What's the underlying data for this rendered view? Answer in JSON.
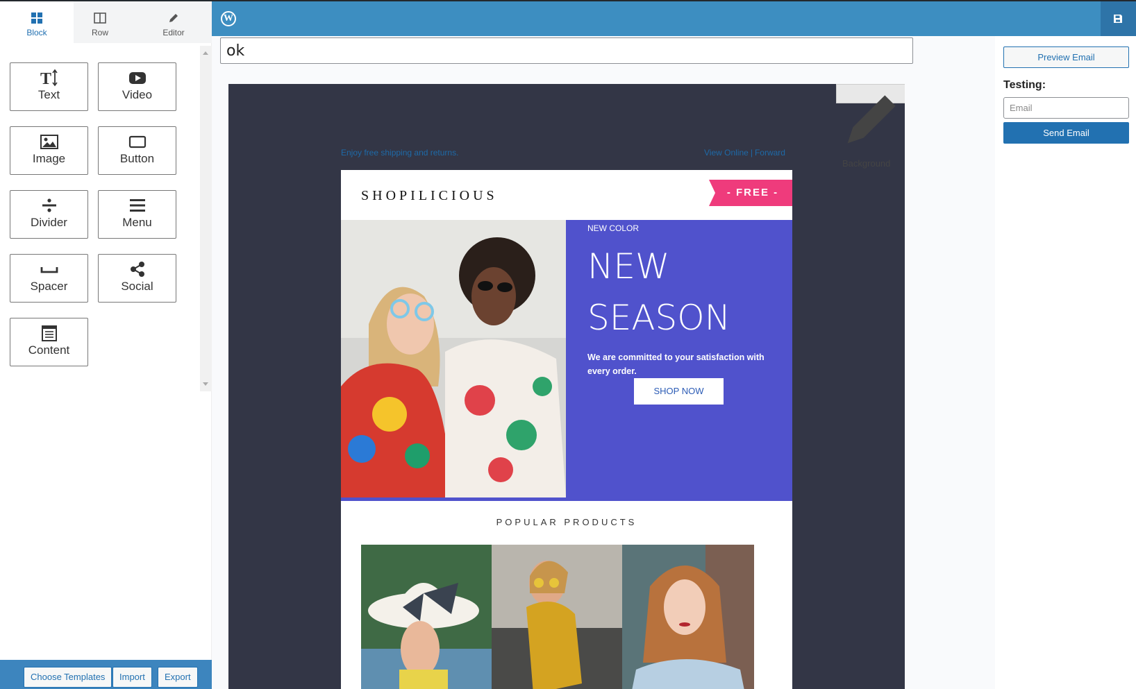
{
  "left_panel": {
    "tabs": [
      {
        "label": "Block",
        "icon": "grid-icon",
        "active": true
      },
      {
        "label": "Row",
        "icon": "columns-icon",
        "active": false
      },
      {
        "label": "Editor",
        "icon": "pencil-icon",
        "active": false
      }
    ],
    "blocks": [
      {
        "label": "Text",
        "icon": "text-icon"
      },
      {
        "label": "Video",
        "icon": "youtube-icon"
      },
      {
        "label": "Image",
        "icon": "image-icon"
      },
      {
        "label": "Button",
        "icon": "button-icon"
      },
      {
        "label": "Divider",
        "icon": "divide-icon"
      },
      {
        "label": "Menu",
        "icon": "menu-icon"
      },
      {
        "label": "Spacer",
        "icon": "spacer-icon"
      },
      {
        "label": "Social",
        "icon": "share-icon"
      },
      {
        "label": "Content",
        "icon": "content-icon"
      }
    ],
    "footer": {
      "choose_templates": "Choose Templates",
      "import": "Import",
      "export": "Export"
    }
  },
  "header": {
    "logo_icon": "wordpress-icon",
    "save_icon": "save-icon",
    "color": "#3d8ec1"
  },
  "editor": {
    "subject": "ok",
    "background_button": "Background"
  },
  "email": {
    "preheader": "Enjoy free shipping and returns.",
    "view_online": "View Online",
    "separator": "|",
    "forward": "Forward",
    "brand": "SHOPILICIOUS",
    "ribbon": "- FREE -",
    "new_color": "NEW COLOR",
    "title_line1": "NEW",
    "title_line2": "SEASON",
    "commitment": "We are committed to your satisfaction with every order.",
    "shop_now": "SHOP NOW",
    "popular_products": "POPULAR PRODUCTS",
    "colors": {
      "background": "#333646",
      "hero": "#5052cc",
      "ribbon": "#ef3b7c"
    }
  },
  "right_panel": {
    "preview_email": "Preview Email",
    "testing_label": "Testing:",
    "email_placeholder": "Email",
    "send_email": "Send Email",
    "accent": "#2271b1"
  }
}
